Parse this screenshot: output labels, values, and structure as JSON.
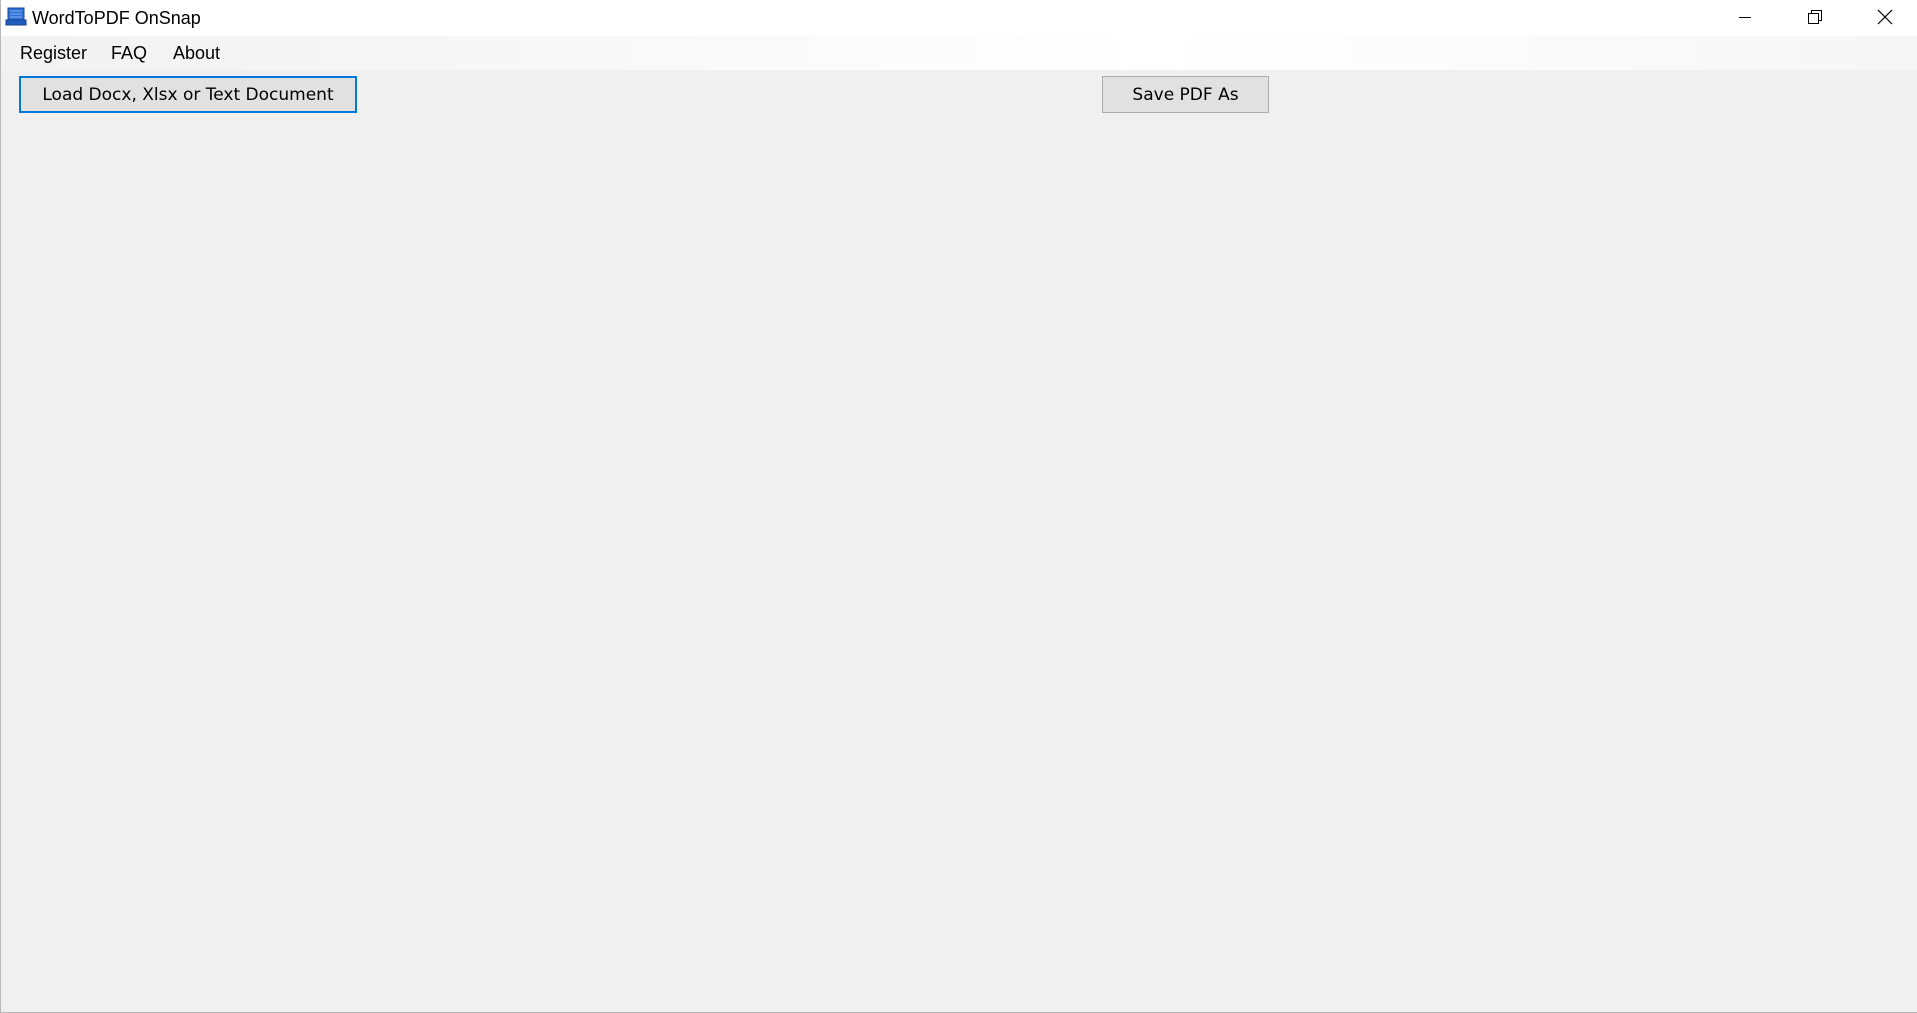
{
  "window": {
    "title": "WordToPDF OnSnap",
    "icon": "printer-app-icon",
    "controls": {
      "minimize_icon": "minimize-icon",
      "restore_icon": "restore-icon",
      "close_icon": "close-icon"
    }
  },
  "menu": {
    "items": [
      {
        "label": "Register"
      },
      {
        "label": "FAQ"
      },
      {
        "label": "About"
      }
    ]
  },
  "toolbar": {
    "load_label": "Load Docx, Xlsx or Text Document",
    "save_label": "Save PDF As"
  },
  "colors": {
    "background": "#f0f0f0",
    "focus_border": "#0078d7",
    "button_face": "#e1e1e1",
    "button_border": "#adadad",
    "app_icon": "#1f5fbf"
  }
}
